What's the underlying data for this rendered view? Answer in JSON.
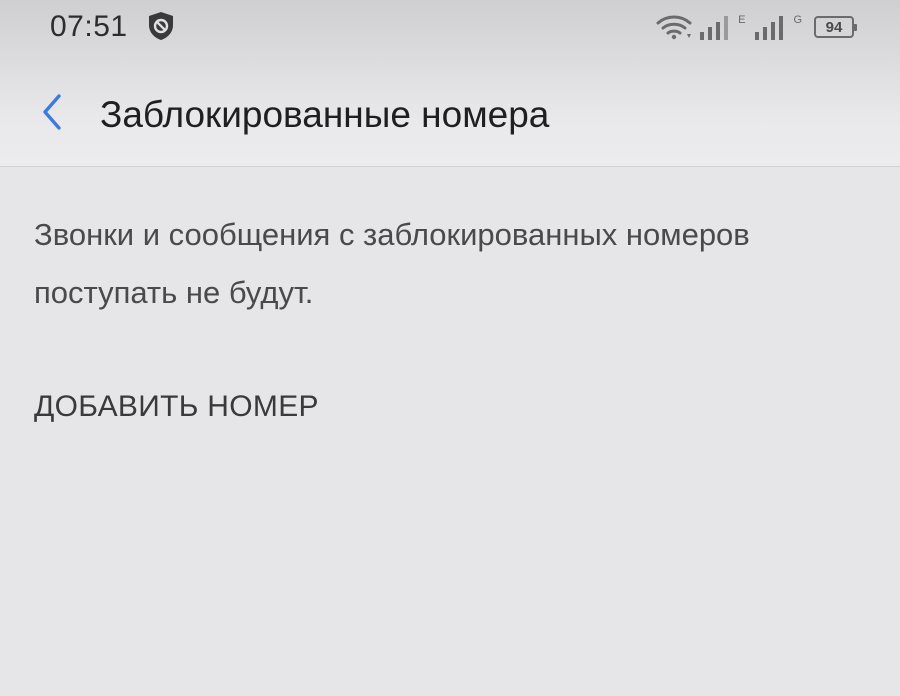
{
  "status_bar": {
    "time": "07:51",
    "shield_icon": "shield-icon",
    "wifi_icon": "wifi-icon",
    "signal_icon_1": "signal-bars-icon",
    "network_type_1": "E",
    "signal_icon_2": "signal-bars-icon",
    "network_type_2": "G",
    "battery_level": "94"
  },
  "app_bar": {
    "back_icon": "chevron-left-icon",
    "title": "Заблокированные номера"
  },
  "content": {
    "description": "Звонки и сообщения с заблокированных номеров поступать не будут.",
    "add_number_label": "ДОБАВИТЬ НОМЕР"
  },
  "colors": {
    "background": "#e6e6e8",
    "accent": "#3d7ae0",
    "title_text": "#1f1f21",
    "body_text": "#4a4a4c"
  }
}
